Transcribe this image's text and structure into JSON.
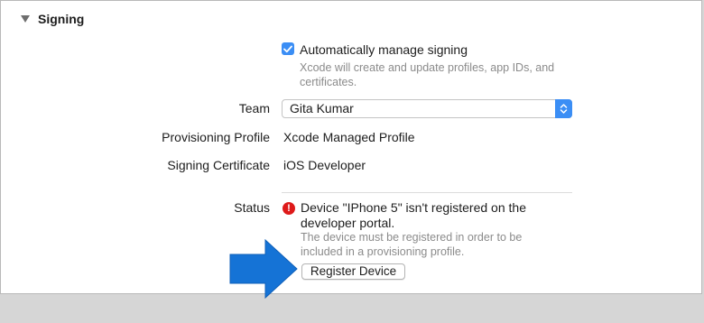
{
  "section": {
    "title": "Signing"
  },
  "auto_signing": {
    "label": "Automatically manage signing",
    "checked": true,
    "description_line1": "Xcode will create and update profiles, app IDs, and",
    "description_line2": "certificates."
  },
  "team": {
    "label": "Team",
    "value": "Gita Kumar"
  },
  "provisioning_profile": {
    "label": "Provisioning Profile",
    "value": "Xcode Managed Profile"
  },
  "signing_certificate": {
    "label": "Signing Certificate",
    "value": "iOS Developer"
  },
  "status": {
    "label": "Status",
    "error_line1": "Device \"IPhone 5\" isn't registered on the",
    "error_line2": "developer portal.",
    "detail_line1": "The device must be registered in order to be",
    "detail_line2": "included in a provisioning profile.",
    "button_label": "Register Device"
  },
  "colors": {
    "accent": "#3b8ef5",
    "error": "#de1a1a",
    "callout_arrow": "#1573d6"
  },
  "icons": [
    "disclosure-triangle-icon",
    "checkmark-icon",
    "popup-arrows-icon",
    "error-icon",
    "callout-arrow-icon"
  ]
}
